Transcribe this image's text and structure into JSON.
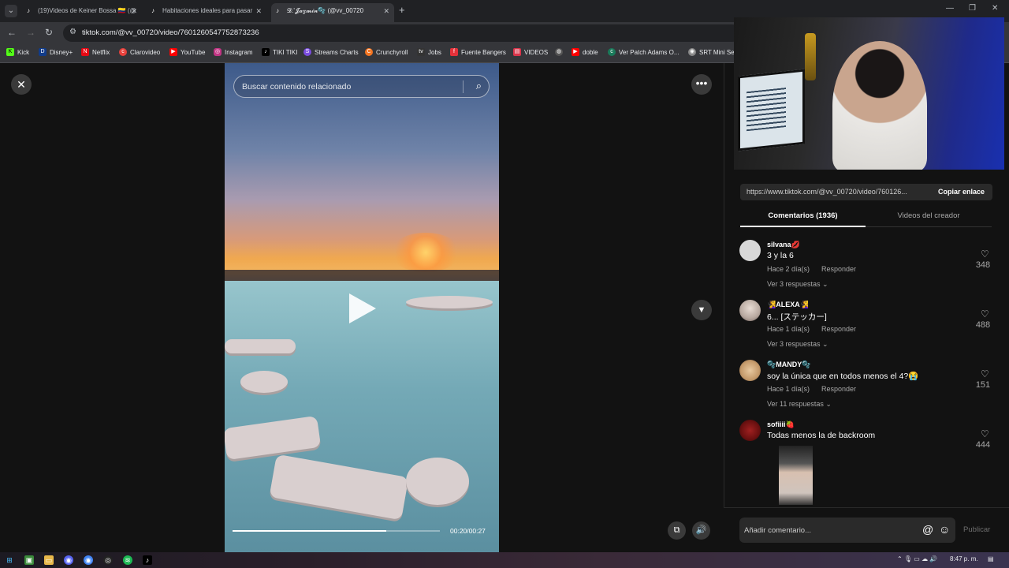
{
  "browser": {
    "tabs": [
      {
        "title": "(19)Videos de Keiner Bossa 🇨🇴 (@",
        "active": false
      },
      {
        "title": "Habitaciones ideales para pasar",
        "active": false
      },
      {
        "title": "𝓓.'𝓙𝓪𝔃𝓶𝓲𝓷🫧 (@vv_00720",
        "active": true
      }
    ],
    "url": "tiktok.com/@vv_00720/video/7601260547752873236",
    "bookmarks": [
      "Kick",
      "Disney+",
      "Netflix",
      "Clarovideo",
      "YouTube",
      "Instagram",
      "TIKI TIKI",
      "Streams Charts",
      "Crunchyroll",
      "Jobs",
      "Fuente Bangers",
      "VIDEOS",
      "doble",
      "Ver Patch Adams O...",
      "SRT Mini Se"
    ]
  },
  "player": {
    "search_placeholder": "Buscar contenido relacionado",
    "timecode": "00:20/00:27",
    "progress": 0.74
  },
  "panel": {
    "share_link": "https://www.tiktok.com/@vv_00720/video/760126...",
    "copy_label": "Copiar enlace",
    "tab_comments": "Comentarios (1936)",
    "tab_creator": "Videos del creador",
    "comments": [
      {
        "user": "silvana💋",
        "text": "3 y la 6",
        "time": "Hace 2 día(s)",
        "reply": "Responder",
        "more": "Ver 3 respuestas ⌄",
        "likes": "348"
      },
      {
        "user": "🧏‍♀️ALEXA🧏‍♀️",
        "text": "6... [ステッカー]",
        "time": "Hace 1 día(s)",
        "reply": "Responder",
        "more": "Ver 3 respuestas ⌄",
        "likes": "488"
      },
      {
        "user": "🫧MANDY🫧",
        "text": "soy la única que en todos menos el 4?😭",
        "time": "Hace 1 día(s)",
        "reply": "Responder",
        "more": "Ver 11 respuestas ⌄",
        "likes": "151"
      },
      {
        "user": "sofiiii🍓",
        "text": "Todas menos la de backroom",
        "time": "",
        "reply": "",
        "more": "",
        "likes": "444"
      }
    ],
    "add_placeholder": "Añadir comentario...",
    "publish_label": "Publicar"
  },
  "taskbar": {
    "clock": "8:47 p. m."
  }
}
